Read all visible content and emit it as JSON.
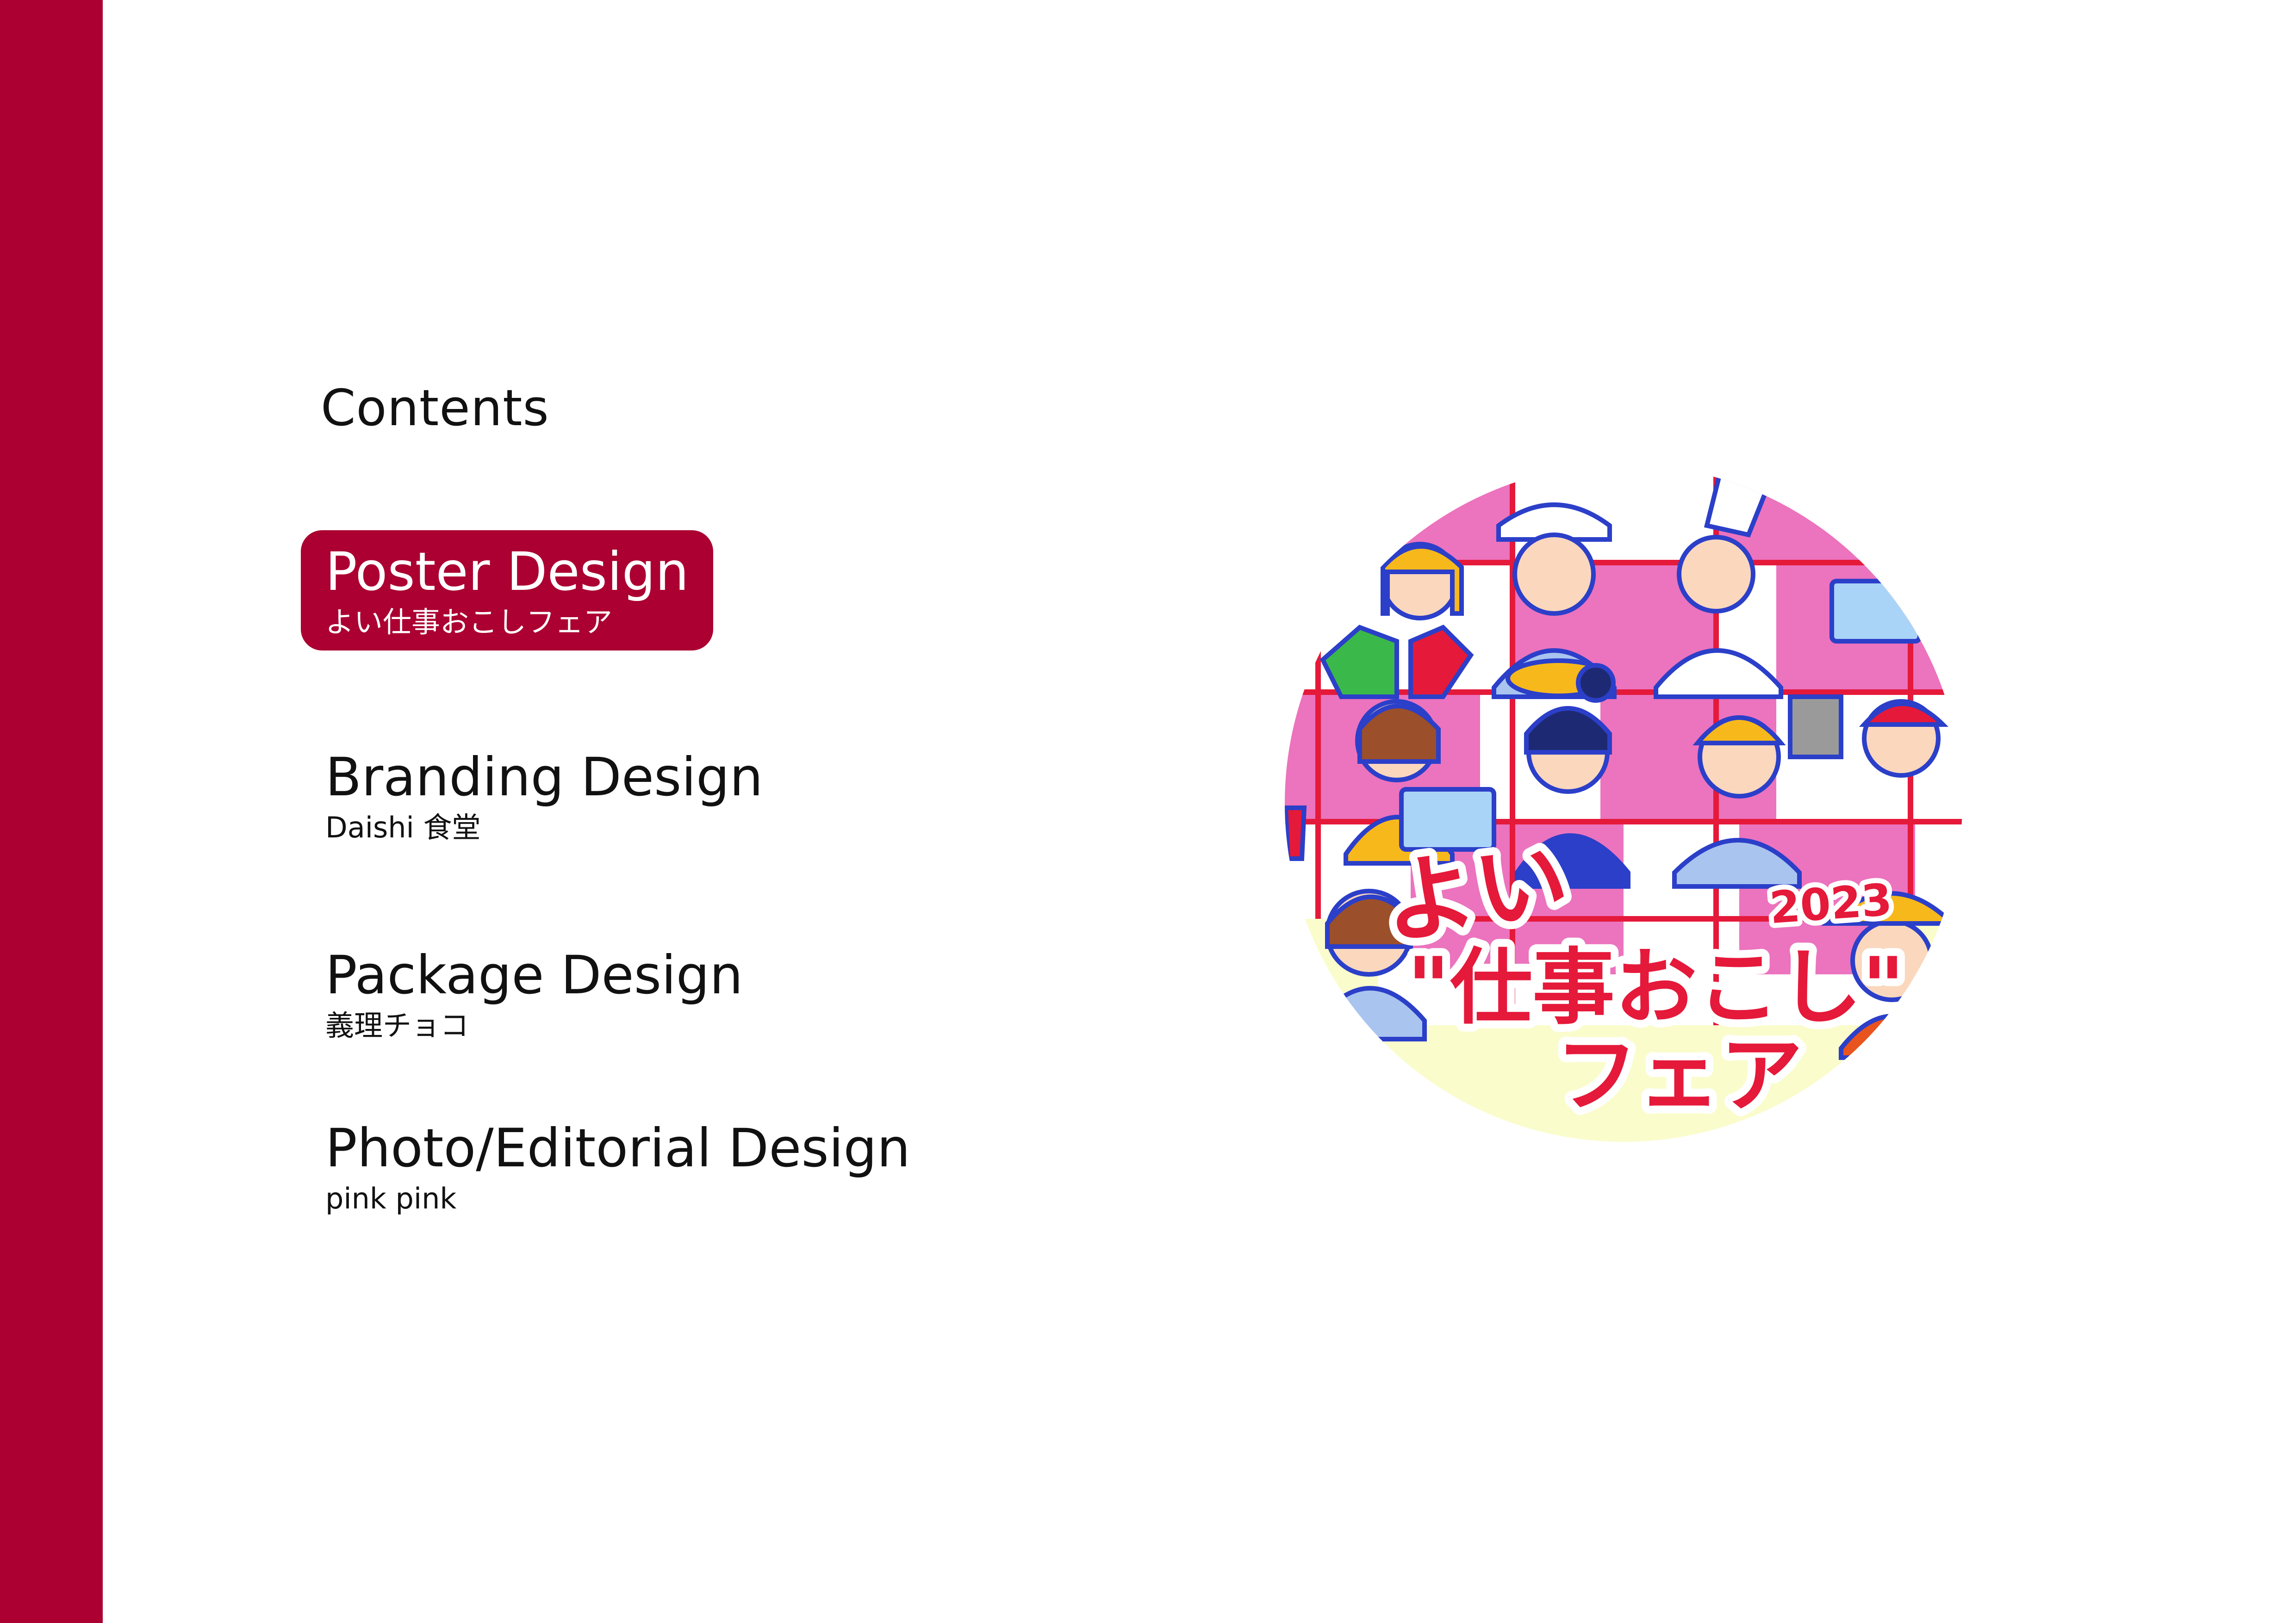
{
  "contents": {
    "heading": "Contents",
    "items": [
      {
        "title": "Poster Design",
        "subtitle": "よい仕事おこしフェア",
        "active": true
      },
      {
        "title": "Branding Design",
        "subtitle": "Daishi 食堂",
        "active": false
      },
      {
        "title": "Package Design",
        "subtitle": "義理チョコ",
        "active": false
      },
      {
        "title": "Photo/Editorial Design",
        "subtitle": "pink pink",
        "active": false
      }
    ]
  },
  "poster": {
    "year": "2023",
    "line1": "よい",
    "line2": "\"仕事おこし\"",
    "line3": "フェア"
  },
  "colors": {
    "accent": "#ab0031",
    "poster_pink": "#ec73be",
    "poster_red": "#e5193a",
    "poster_yellow": "#fafccc",
    "illustration_blue": "#2b3fc9"
  }
}
